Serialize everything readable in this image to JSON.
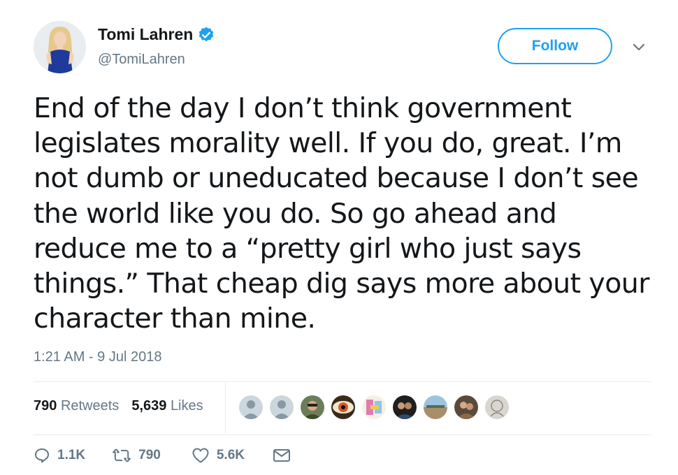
{
  "author": {
    "name": "Tomi Lahren",
    "handle": "@TomiLahren",
    "verified": true
  },
  "follow_label": "Follow",
  "tweet": {
    "lines": [
      "End of the day I don’t think government",
      "legislates morality well. If you do, great. I’m",
      "not dumb or uneducated because I don’t see",
      "the world like you do. So go ahead and",
      "reduce me to a “pretty girl who just says",
      "things.” That cheap dig says more about your",
      "character than mine."
    ],
    "timestamp": "1:21 AM - 9 Jul 2018"
  },
  "stats": {
    "retweets_count": "790",
    "retweets_label": "Retweets",
    "likes_count": "5,639",
    "likes_label": "Likes"
  },
  "likers": [
    "default-avatar",
    "default-avatar",
    "profile-photo",
    "eye-art",
    "pray-for-me-art",
    "profile-photo",
    "landscape-photo",
    "profile-photo",
    "sketch-portrait"
  ],
  "actions": {
    "replies": "1.1K",
    "retweets": "790",
    "likes": "5.6K"
  },
  "colors": {
    "accent": "#1da1f2",
    "text": "#14171a",
    "muted": "#657786",
    "divider": "#e6ecf0"
  }
}
